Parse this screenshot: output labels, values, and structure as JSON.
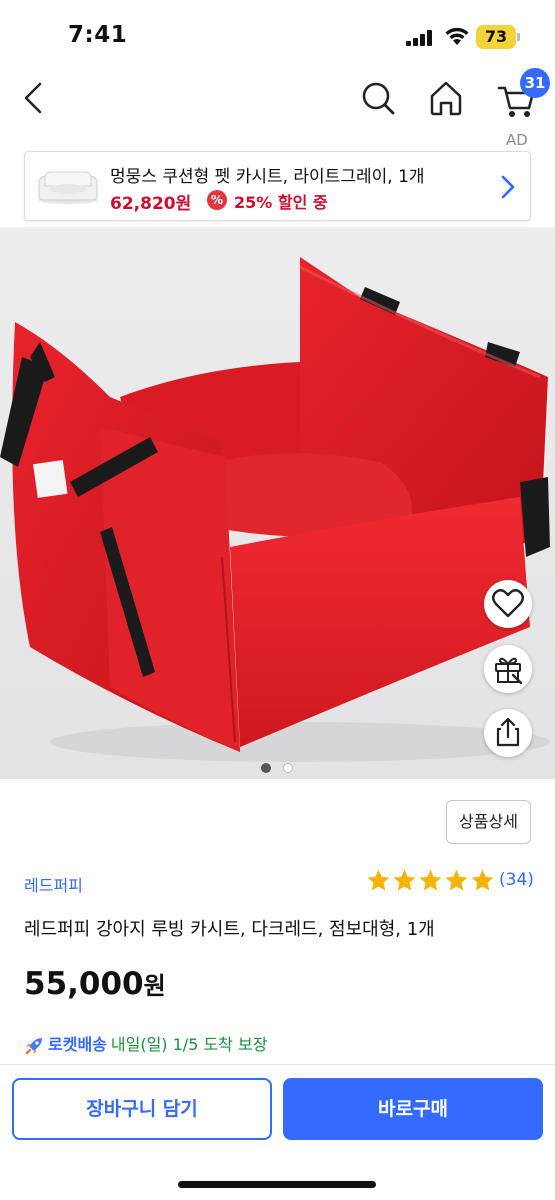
{
  "status_bar": {
    "time": "7:41",
    "battery": "73"
  },
  "nav": {
    "cart_badge": "31"
  },
  "ad": {
    "label": "AD",
    "title": "멍뭉스 쿠션형 펫 카시트, 라이트그레이, 1개",
    "price": "62,820원",
    "discount_icon": "%",
    "discount_text": "25% 할인 중"
  },
  "product": {
    "detail_button": "상품상세",
    "brand": "레드퍼피",
    "rating": 5,
    "review_count": "(34)",
    "title": "레드퍼피 강아지 루빙 카시트, 다크레드, 점보대형, 1개",
    "price": "55,000",
    "price_unit": "원",
    "rocket_label": "로켓배송",
    "delivery": "내일(일) 1/5 도착 보장",
    "image_count": 2,
    "image_index": 1
  },
  "actions": {
    "add_to_cart": "장바구니 담기",
    "buy_now": "바로구매"
  },
  "colors": {
    "accent": "#346aff",
    "price_red": "#c8102e",
    "star": "#f6b400",
    "rocket_green": "#1b8f3a"
  },
  "icons": [
    "back-icon",
    "search-icon",
    "home-icon",
    "cart-icon",
    "chevron-right-icon",
    "heart-icon",
    "gift-icon",
    "share-icon",
    "star-icon",
    "rocket-icon"
  ]
}
